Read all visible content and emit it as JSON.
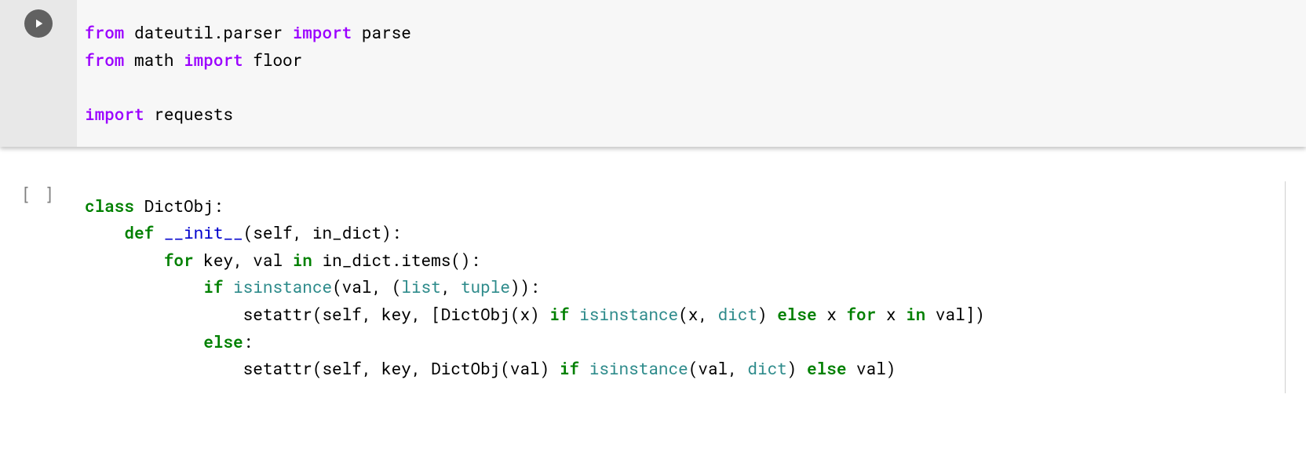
{
  "cells": [
    {
      "status": "runnable",
      "lines": [
        [
          {
            "t": "from ",
            "c": "kw-from"
          },
          {
            "t": "dateutil.parser ",
            "c": ""
          },
          {
            "t": "import ",
            "c": "kw-i"
          },
          {
            "t": "parse",
            "c": ""
          }
        ],
        [
          {
            "t": "from ",
            "c": "kw-from"
          },
          {
            "t": "math ",
            "c": ""
          },
          {
            "t": "import ",
            "c": "kw-i"
          },
          {
            "t": "floor",
            "c": ""
          }
        ],
        [
          {
            "t": "",
            "c": ""
          }
        ],
        [
          {
            "t": "import ",
            "c": "kw-i"
          },
          {
            "t": "requests",
            "c": ""
          }
        ]
      ]
    },
    {
      "status": "idle",
      "exec_label": "[ ]",
      "lines": [
        [
          {
            "t": "class ",
            "c": "kw"
          },
          {
            "t": "DictObj",
            "c": ""
          },
          {
            "t": ":",
            "c": ""
          }
        ],
        [
          {
            "t": "    ",
            "c": ""
          },
          {
            "t": "def ",
            "c": "kw"
          },
          {
            "t": "__init__",
            "c": "fn"
          },
          {
            "t": "(self, in_dict):",
            "c": ""
          }
        ],
        [
          {
            "t": "        ",
            "c": ""
          },
          {
            "t": "for ",
            "c": "kw"
          },
          {
            "t": "key, val ",
            "c": ""
          },
          {
            "t": "in ",
            "c": "kw"
          },
          {
            "t": "in_dict.items():",
            "c": ""
          }
        ],
        [
          {
            "t": "            ",
            "c": ""
          },
          {
            "t": "if ",
            "c": "kw"
          },
          {
            "t": "isinstance",
            "c": "bi"
          },
          {
            "t": "(val, (",
            "c": ""
          },
          {
            "t": "list",
            "c": "bi"
          },
          {
            "t": ", ",
            "c": ""
          },
          {
            "t": "tuple",
            "c": "bi"
          },
          {
            "t": ")):",
            "c": ""
          }
        ],
        [
          {
            "t": "                setattr(self, key, [DictObj(x) ",
            "c": ""
          },
          {
            "t": "if ",
            "c": "kw"
          },
          {
            "t": "isinstance",
            "c": "bi"
          },
          {
            "t": "(x, ",
            "c": ""
          },
          {
            "t": "dict",
            "c": "bi"
          },
          {
            "t": ") ",
            "c": ""
          },
          {
            "t": "else ",
            "c": "kw"
          },
          {
            "t": "x ",
            "c": ""
          },
          {
            "t": "for ",
            "c": "kw"
          },
          {
            "t": "x ",
            "c": ""
          },
          {
            "t": "in ",
            "c": "kw"
          },
          {
            "t": "val])",
            "c": ""
          }
        ],
        [
          {
            "t": "            ",
            "c": ""
          },
          {
            "t": "else",
            "c": "kw"
          },
          {
            "t": ":",
            "c": ""
          }
        ],
        [
          {
            "t": "                setattr(self, key, DictObj(val) ",
            "c": ""
          },
          {
            "t": "if ",
            "c": "kw"
          },
          {
            "t": "isinstance",
            "c": "bi"
          },
          {
            "t": "(val, ",
            "c": ""
          },
          {
            "t": "dict",
            "c": "bi"
          },
          {
            "t": ") ",
            "c": ""
          },
          {
            "t": "else ",
            "c": "kw"
          },
          {
            "t": "val)",
            "c": ""
          }
        ]
      ]
    }
  ]
}
